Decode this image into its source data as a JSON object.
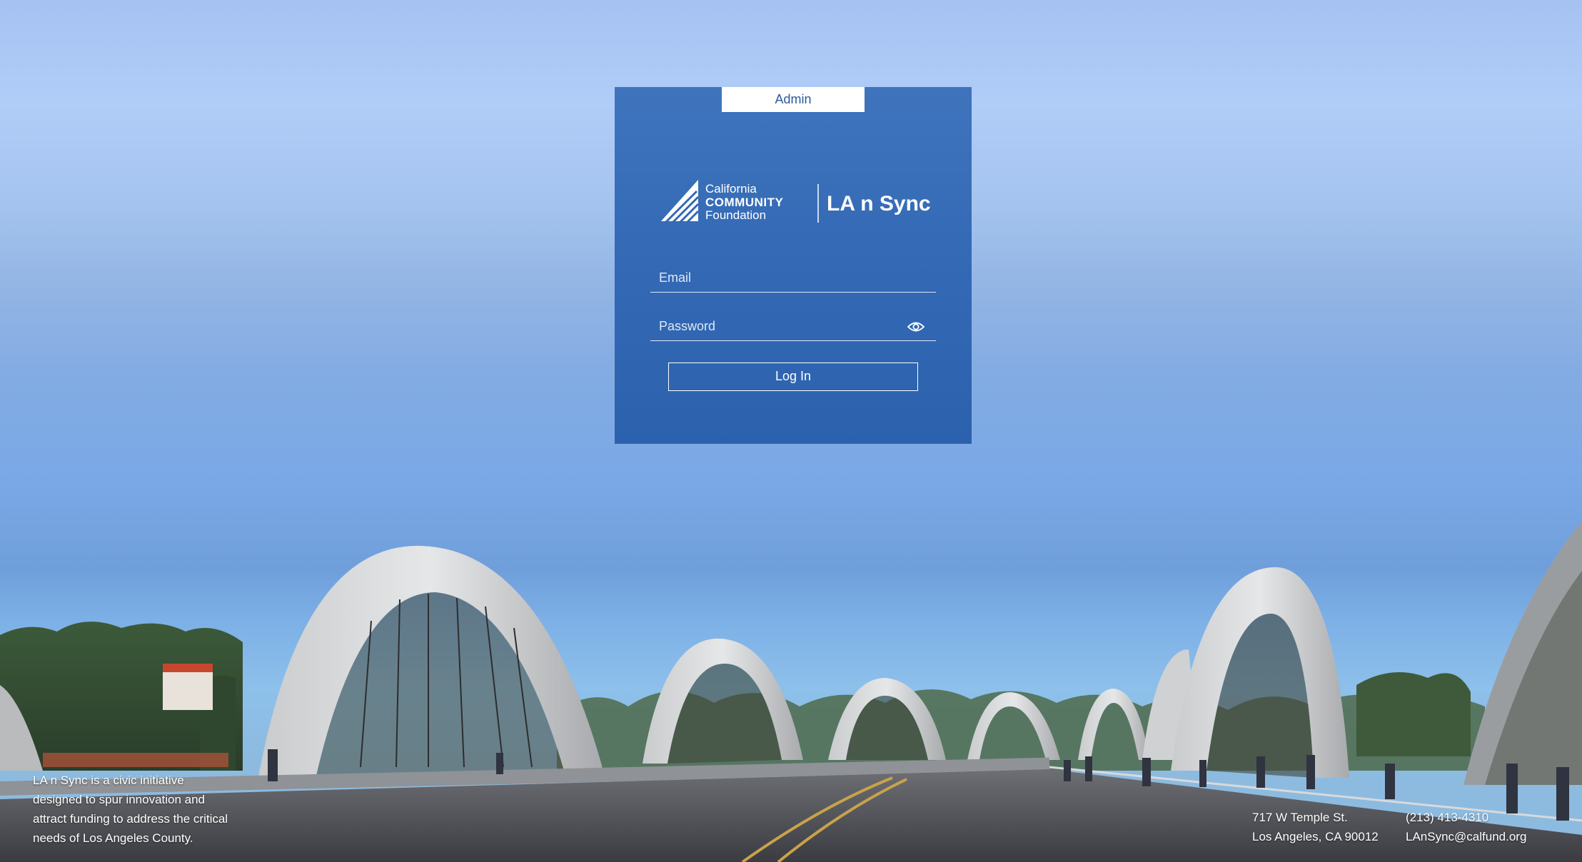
{
  "login_card": {
    "tab_label": "Admin",
    "logo": {
      "org_line1": "California",
      "org_line2": "COMMUNITY",
      "org_line3": "Foundation",
      "product": "LA n Sync"
    },
    "email": {
      "placeholder": "Email",
      "value": ""
    },
    "password": {
      "placeholder": "Password",
      "value": "",
      "toggle_icon": "eye-icon"
    },
    "login_button": "Log In"
  },
  "footer": {
    "description_lines": [
      "LA n Sync is a civic initiative",
      "designed to spur innovation and",
      "attract funding to address the critical",
      "needs of Los Angeles County."
    ],
    "address": {
      "street": "717 W Temple St.",
      "city": "Los Angeles, CA 90012"
    },
    "contact": {
      "phone": "(213) 413-4310",
      "email": "LAnSync@calfund.org"
    }
  },
  "colors": {
    "card_bg": "#3268b4",
    "tab_text": "#2a5a9b",
    "sky_top": "#a6c2f2",
    "sky_bottom": "#8dc0ea"
  }
}
